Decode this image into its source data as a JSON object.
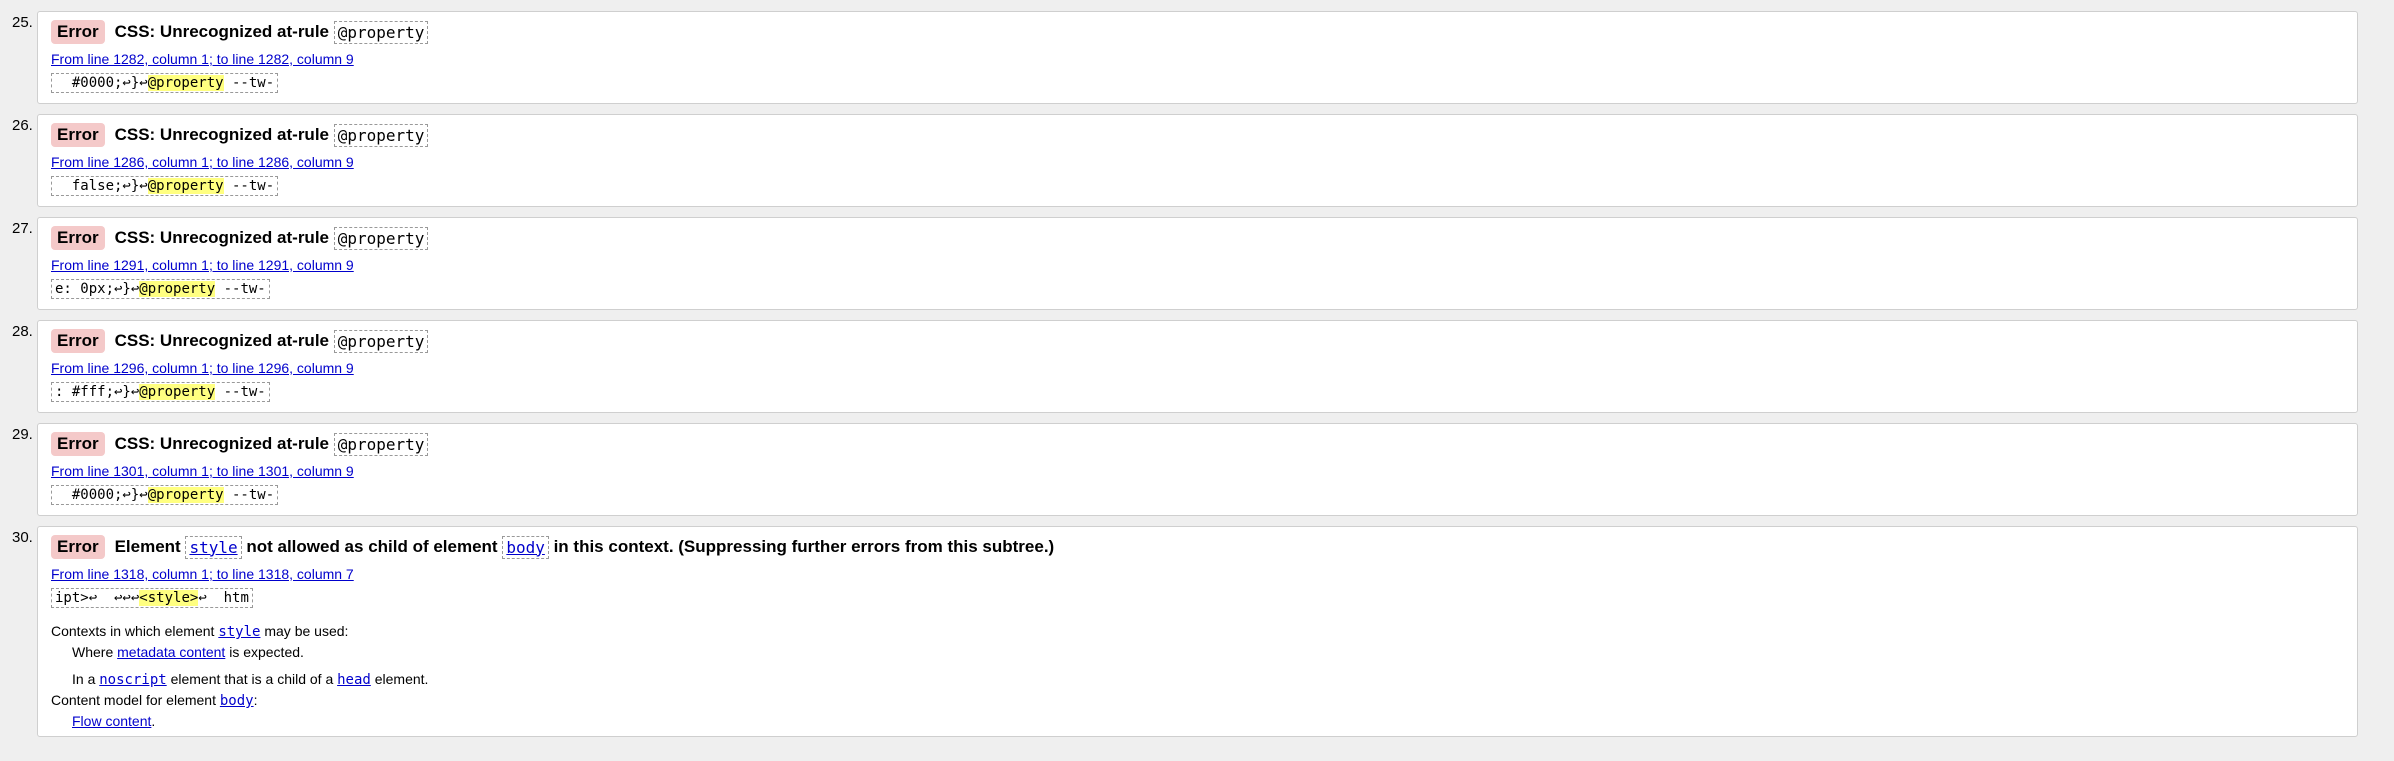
{
  "messages": [
    {
      "num": "25.",
      "badge": "Error",
      "title_pre": "CSS: Unrecognized at-rule",
      "title_code": "@property",
      "location": "From line 1282, column 1; to line 1282, column 9",
      "extract_pre": "  #0000;↩}↩",
      "extract_hl": "@property",
      "extract_post": " --tw-"
    },
    {
      "num": "26.",
      "badge": "Error",
      "title_pre": "CSS: Unrecognized at-rule",
      "title_code": "@property",
      "location": "From line 1286, column 1; to line 1286, column 9",
      "extract_pre": "  false;↩}↩",
      "extract_hl": "@property",
      "extract_post": " --tw-"
    },
    {
      "num": "27.",
      "badge": "Error",
      "title_pre": "CSS: Unrecognized at-rule",
      "title_code": "@property",
      "location": "From line 1291, column 1; to line 1291, column 9",
      "extract_pre": "e: 0px;↩}↩",
      "extract_hl": "@property",
      "extract_post": " --tw-"
    },
    {
      "num": "28.",
      "badge": "Error",
      "title_pre": "CSS: Unrecognized at-rule",
      "title_code": "@property",
      "location": "From line 1296, column 1; to line 1296, column 9",
      "extract_pre": ": #fff;↩}↩",
      "extract_hl": "@property",
      "extract_post": " --tw-"
    },
    {
      "num": "29.",
      "badge": "Error",
      "title_pre": "CSS: Unrecognized at-rule",
      "title_code": "@property",
      "location": "From line 1301, column 1; to line 1301, column 9",
      "extract_pre": "  #0000;↩}↩",
      "extract_hl": "@property",
      "extract_post": " --tw-"
    }
  ],
  "message30": {
    "num": "30.",
    "badge": "Error",
    "t1": "Element ",
    "code1": "style",
    "t2": " not allowed as child of element ",
    "code2": "body",
    "t3": " in this context. (Suppressing further errors from this subtree.)",
    "location": "From line 1318, column 1; to line 1318, column 7",
    "extract_pre": "ipt>↩  ↩↩↩",
    "extract_hl": "<style>",
    "extract_post": "↩  htm",
    "ctx_pre": "Contexts in which element ",
    "ctx_code": "style",
    "ctx_post": " may be used:",
    "where_pre": "Where ",
    "where_link": "metadata content",
    "where_post": " is expected.",
    "ina_pre": "In a ",
    "ina_code": "noscript",
    "ina_mid": " element that is a child of a ",
    "ina_code2": "head",
    "ina_post": " element.",
    "cm_pre": "Content model for element ",
    "cm_code": "body",
    "cm_post": ":",
    "flow_link": "Flow content",
    "flow_post": "."
  },
  "colors": {
    "badge_bg": "#f4c9c9",
    "link": "#0000cc",
    "highlight": "#ffff80",
    "page_bg": "#efefef"
  }
}
